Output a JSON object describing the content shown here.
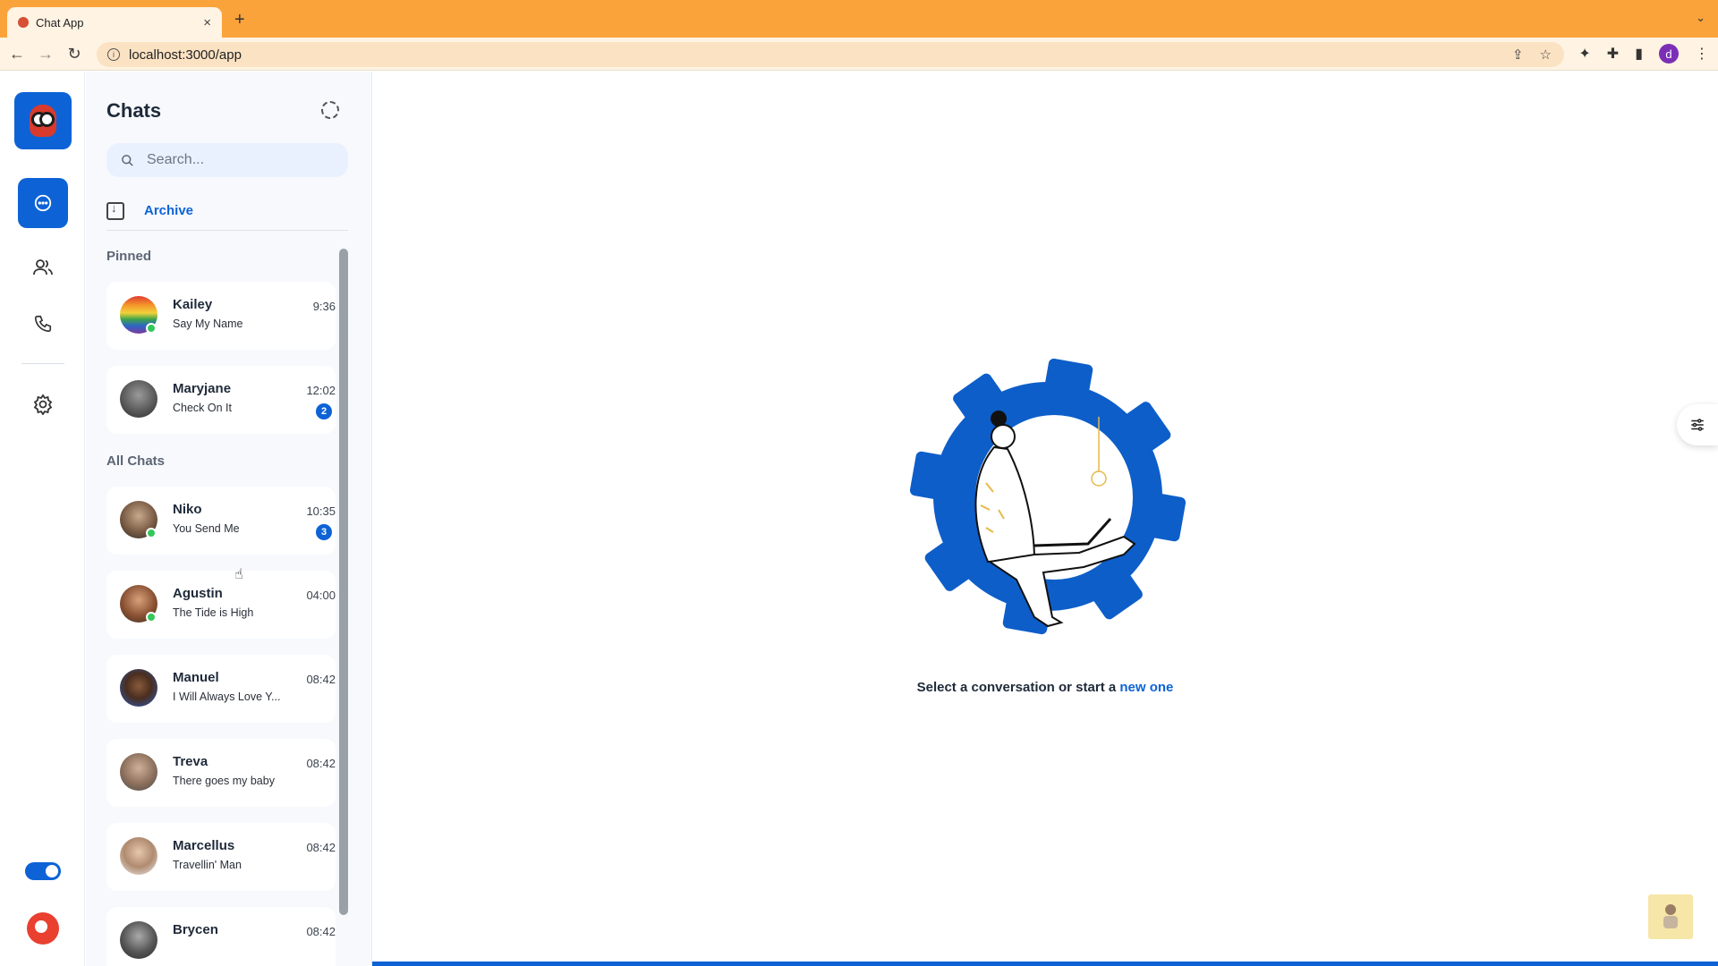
{
  "browser": {
    "tab_title": "Chat App",
    "tab_close": "×",
    "new_tab": "+",
    "url": "localhost:3000/app",
    "profile_initial": "d"
  },
  "rail": {
    "items": [
      {
        "name": "chats",
        "icon": "chat-bubble-icon",
        "active": true
      },
      {
        "name": "contacts",
        "icon": "users-icon",
        "active": false
      },
      {
        "name": "calls",
        "icon": "phone-icon",
        "active": false
      },
      {
        "name": "settings",
        "icon": "gear-icon",
        "active": false
      }
    ],
    "theme_toggle_on": true
  },
  "panel": {
    "title": "Chats",
    "search_placeholder": "Search...",
    "archive_label": "Archive",
    "pinned_label": "Pinned",
    "all_chats_label": "All Chats"
  },
  "pinned": [
    {
      "name": "Kailey",
      "message": "Say My Name",
      "time": "9:36",
      "online": true,
      "unread": ""
    },
    {
      "name": "Maryjane",
      "message": "Check On It",
      "time": "12:02",
      "online": false,
      "unread": "2"
    }
  ],
  "chats": [
    {
      "name": "Niko",
      "message": "You Send Me",
      "time": "10:35",
      "online": true,
      "unread": "3"
    },
    {
      "name": "Agustin",
      "message": "The Tide is High",
      "time": "04:00",
      "online": true,
      "unread": ""
    },
    {
      "name": "Manuel",
      "message": "I Will Always Love Y...",
      "time": "08:42",
      "online": false,
      "unread": ""
    },
    {
      "name": "Treva",
      "message": "There goes my baby",
      "time": "08:42",
      "online": false,
      "unread": ""
    },
    {
      "name": "Marcellus",
      "message": "Travellin' Man",
      "time": "08:42",
      "online": false,
      "unread": ""
    },
    {
      "name": "Brycen",
      "message": "",
      "time": "08:42",
      "online": false,
      "unread": ""
    }
  ],
  "main": {
    "prompt_text": "Select a conversation or start a ",
    "prompt_link": "new one"
  },
  "colors": {
    "accent": "#0d63d6",
    "online": "#34c759",
    "browser_tabbar": "#fba33b"
  }
}
